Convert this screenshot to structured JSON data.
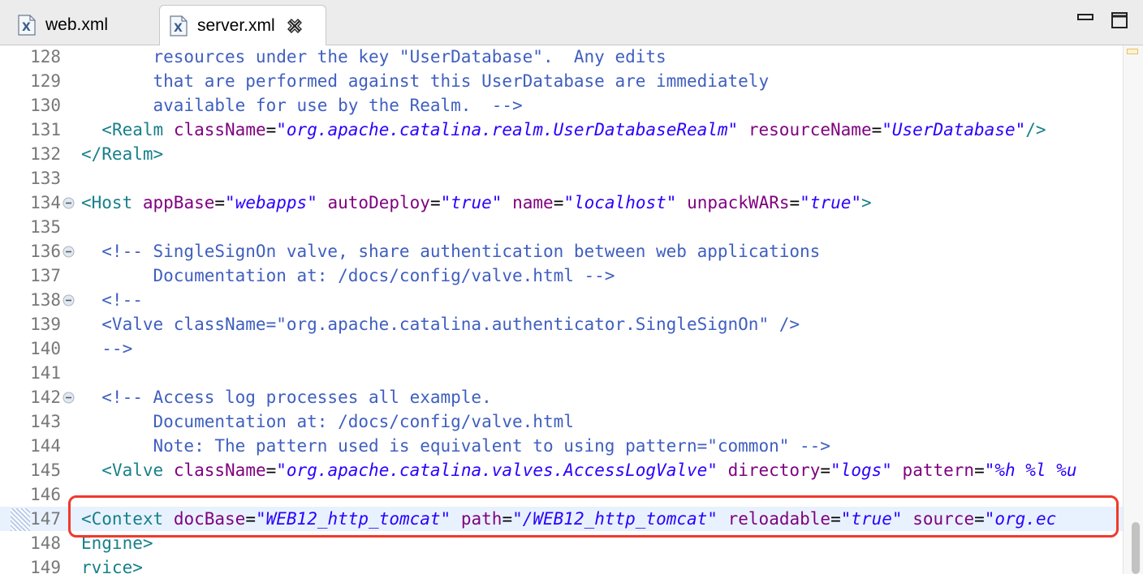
{
  "tabs": [
    {
      "label": "web.xml",
      "icon": "xml-file-icon",
      "active": false
    },
    {
      "label": "server.xml",
      "icon": "xml-file-icon",
      "active": true
    }
  ],
  "colors": {
    "comment": "#3f5fbf",
    "tag": "#17808a",
    "attribute": "#7f007f",
    "string": "#2a00ff",
    "highlight_box": "#f0392b",
    "current_line": "#e8f2fe"
  },
  "editor": {
    "lines": [
      {
        "num": "128",
        "fold": false,
        "segments": [
          [
            "c",
            "       resources under the key \"UserDatabase\".  Any edits"
          ]
        ]
      },
      {
        "num": "129",
        "fold": false,
        "segments": [
          [
            "c",
            "       that are performed against this UserDatabase are immediately"
          ]
        ]
      },
      {
        "num": "130",
        "fold": false,
        "segments": [
          [
            "c",
            "       available for use by the Realm.  -->"
          ]
        ]
      },
      {
        "num": "131",
        "fold": false,
        "segments": [
          [
            "p",
            "  "
          ],
          [
            "t",
            "<Realm"
          ],
          [
            "p",
            " "
          ],
          [
            "a",
            "className"
          ],
          [
            "e",
            "="
          ],
          [
            "s",
            "\"org.apache.catalina.realm.UserDatabaseRealm\""
          ],
          [
            "p",
            " "
          ],
          [
            "a",
            "resourceName"
          ],
          [
            "e",
            "="
          ],
          [
            "s",
            "\"UserDatabase\""
          ],
          [
            "t",
            "/>"
          ]
        ]
      },
      {
        "num": "132",
        "fold": false,
        "segments": [
          [
            "t",
            "</Realm>"
          ]
        ]
      },
      {
        "num": "133",
        "fold": false,
        "segments": []
      },
      {
        "num": "134",
        "fold": true,
        "segments": [
          [
            "t",
            "<Host"
          ],
          [
            "p",
            " "
          ],
          [
            "a",
            "appBase"
          ],
          [
            "e",
            "="
          ],
          [
            "s",
            "\"webapps\""
          ],
          [
            "p",
            " "
          ],
          [
            "a",
            "autoDeploy"
          ],
          [
            "e",
            "="
          ],
          [
            "s",
            "\"true\""
          ],
          [
            "p",
            " "
          ],
          [
            "a",
            "name"
          ],
          [
            "e",
            "="
          ],
          [
            "s",
            "\"localhost\""
          ],
          [
            "p",
            " "
          ],
          [
            "a",
            "unpackWARs"
          ],
          [
            "e",
            "="
          ],
          [
            "s",
            "\"true\""
          ],
          [
            "t",
            ">"
          ]
        ]
      },
      {
        "num": "135",
        "fold": false,
        "segments": []
      },
      {
        "num": "136",
        "fold": true,
        "segments": [
          [
            "c",
            "  <!-- SingleSignOn valve, share authentication between web applications"
          ]
        ]
      },
      {
        "num": "137",
        "fold": false,
        "segments": [
          [
            "c",
            "       Documentation at: /docs/config/valve.html -->"
          ]
        ]
      },
      {
        "num": "138",
        "fold": true,
        "segments": [
          [
            "c",
            "  <!--"
          ]
        ]
      },
      {
        "num": "139",
        "fold": false,
        "segments": [
          [
            "c",
            "  <Valve className=\"org.apache.catalina.authenticator.SingleSignOn\" />"
          ]
        ]
      },
      {
        "num": "140",
        "fold": false,
        "segments": [
          [
            "c",
            "  -->"
          ]
        ]
      },
      {
        "num": "141",
        "fold": false,
        "segments": []
      },
      {
        "num": "142",
        "fold": true,
        "segments": [
          [
            "c",
            "  <!-- Access log processes all example."
          ]
        ]
      },
      {
        "num": "143",
        "fold": false,
        "segments": [
          [
            "c",
            "       Documentation at: /docs/config/valve.html"
          ]
        ]
      },
      {
        "num": "144",
        "fold": false,
        "segments": [
          [
            "c",
            "       Note: The pattern used is equivalent to using pattern=\"common\" -->"
          ]
        ]
      },
      {
        "num": "145",
        "fold": false,
        "segments": [
          [
            "p",
            "  "
          ],
          [
            "t",
            "<Valve"
          ],
          [
            "p",
            " "
          ],
          [
            "a",
            "className"
          ],
          [
            "e",
            "="
          ],
          [
            "s",
            "\"org.apache.catalina.valves.AccessLogValve\""
          ],
          [
            "p",
            " "
          ],
          [
            "a",
            "directory"
          ],
          [
            "e",
            "="
          ],
          [
            "s",
            "\"logs\""
          ],
          [
            "p",
            " "
          ],
          [
            "a",
            "pattern"
          ],
          [
            "e",
            "="
          ],
          [
            "s",
            "\"%h %l %u"
          ]
        ]
      },
      {
        "num": "146",
        "fold": false,
        "segments": []
      },
      {
        "num": "147",
        "fold": false,
        "current": true,
        "segments": [
          [
            "t",
            "<Context"
          ],
          [
            "p",
            " "
          ],
          [
            "a",
            "docBase"
          ],
          [
            "e",
            "="
          ],
          [
            "s",
            "\"WEB12_http_tomcat\""
          ],
          [
            "p",
            " "
          ],
          [
            "a",
            "path"
          ],
          [
            "e",
            "="
          ],
          [
            "s",
            "\"/WEB12_http_tomcat\""
          ],
          [
            "p",
            " "
          ],
          [
            "a",
            "reloadable"
          ],
          [
            "e",
            "="
          ],
          [
            "s",
            "\"true\""
          ],
          [
            "p",
            " "
          ],
          [
            "a",
            "source"
          ],
          [
            "e",
            "="
          ],
          [
            "s",
            "\"org.ec"
          ]
        ]
      },
      {
        "num": "148",
        "fold": false,
        "segments": [
          [
            "t",
            "Engine>"
          ]
        ]
      },
      {
        "num": "149",
        "fold": false,
        "segments": [
          [
            "t",
            "rvice>"
          ]
        ]
      }
    ]
  }
}
